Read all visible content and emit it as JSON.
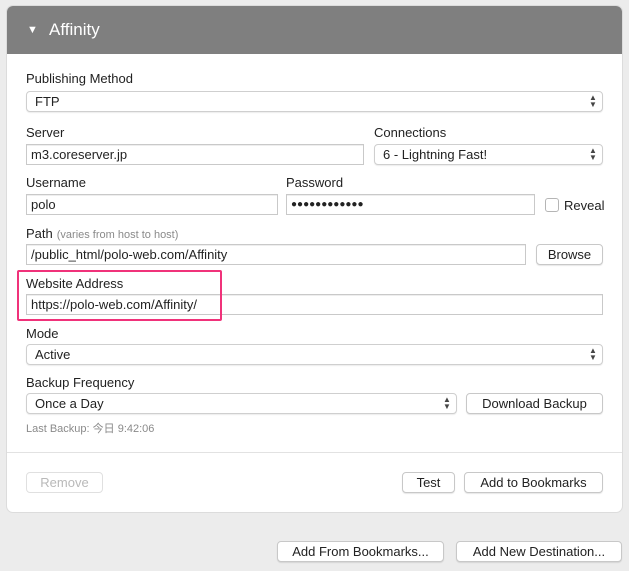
{
  "panel": {
    "title": "Affinity",
    "disclosure_icon": "disclosure-triangle-down-icon"
  },
  "publishing_method": {
    "label": "Publishing Method",
    "value": "FTP"
  },
  "server": {
    "label": "Server",
    "value": "m3.coreserver.jp"
  },
  "connections": {
    "label": "Connections",
    "value": "6 - Lightning Fast!"
  },
  "username": {
    "label": "Username",
    "value": "polo"
  },
  "password": {
    "label": "Password",
    "value": "●●●●●●●●●●●●"
  },
  "reveal": {
    "label": "Reveal",
    "checked": false
  },
  "path": {
    "label": "Path",
    "hint": "(varies from host to host)",
    "value": "/public_html/polo-web.com/Affinity",
    "browse_label": "Browse"
  },
  "website_address": {
    "label": "Website Address",
    "value": "https://polo-web.com/Affinity/",
    "highlight_color": "#f0327a"
  },
  "mode": {
    "label": "Mode",
    "value": "Active"
  },
  "backup_frequency": {
    "label": "Backup Frequency",
    "value": "Once a Day",
    "download_label": "Download Backup"
  },
  "last_backup": "Last Backup: 今日 9:42:06",
  "panel_buttons": {
    "remove": "Remove",
    "test": "Test",
    "add_to_bookmarks": "Add to Bookmarks"
  },
  "footer_buttons": {
    "add_from_bookmarks": "Add From Bookmarks...",
    "add_new_destination": "Add New Destination..."
  }
}
